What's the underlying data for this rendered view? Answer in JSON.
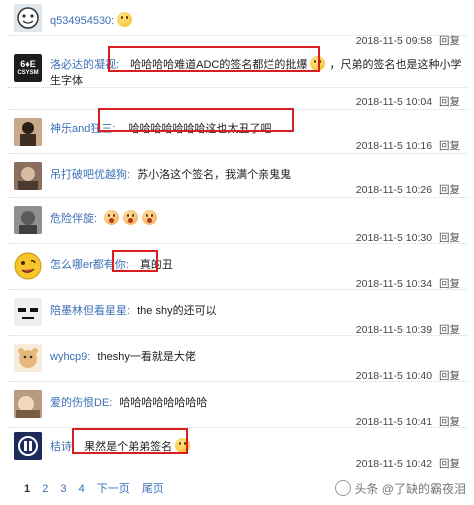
{
  "comments": [
    {
      "user": "q534954530:",
      "text": "",
      "date": "",
      "reply": ""
    },
    {
      "user": "洛必达的凝视:",
      "text": "哈哈哈哈难道ADC的签名都烂的批爆",
      "text2": "，尺弟的签名也是这种小学",
      "text3": "生字体",
      "date": "2018-11-5 09:58",
      "reply": "回复"
    },
    {
      "user": "",
      "text": "",
      "date": "2018-11-5 10:04",
      "reply": "回复"
    },
    {
      "user": "神乐and狂三:",
      "text": "哈哈哈哈哈哈哈这也太丑了吧",
      "date": "2018-11-5 10:16",
      "reply": "回复"
    },
    {
      "user": "吊打破吧优越狗:",
      "text": "苏小洛这个签名，我满个亲鬼鬼",
      "date": "2018-11-5 10:26",
      "reply": "回复"
    },
    {
      "user": "危险伴旋:",
      "text": "",
      "date": "2018-11-5 10:30",
      "reply": "回复"
    },
    {
      "user": "怎么哪er都有你:",
      "text": "真的丑",
      "date": "2018-11-5 10:34",
      "reply": "回复"
    },
    {
      "user": "陪墨林但看星星:",
      "text": "the shy的还可以",
      "date": "2018-11-5 10:39",
      "reply": "回复"
    },
    {
      "user": "wyhcp9:",
      "text": "theshy一看就是大佬",
      "date": "2018-11-5 10:40",
      "reply": "回复"
    },
    {
      "user": "爱的伤恨DE:",
      "text": "哈哈哈哈哈哈哈哈",
      "date": "2018-11-5 10:41",
      "reply": "回复"
    },
    {
      "user": "桔诗:",
      "text": "果然是个弟弟签名",
      "date": "2018-11-5 10:42",
      "reply": "回复"
    }
  ],
  "avatar_badge": {
    "line1": "6♦E",
    "line2": "CSYSM"
  },
  "pager": {
    "p1": "1",
    "p2": "2",
    "p3": "3",
    "p4": "4",
    "next": "下一页",
    "last": "尾页"
  },
  "watermark": "头条 @了缺的霸夜泪",
  "colors": {
    "user": "#3b6fb6",
    "highlight": "#d81e1e"
  }
}
